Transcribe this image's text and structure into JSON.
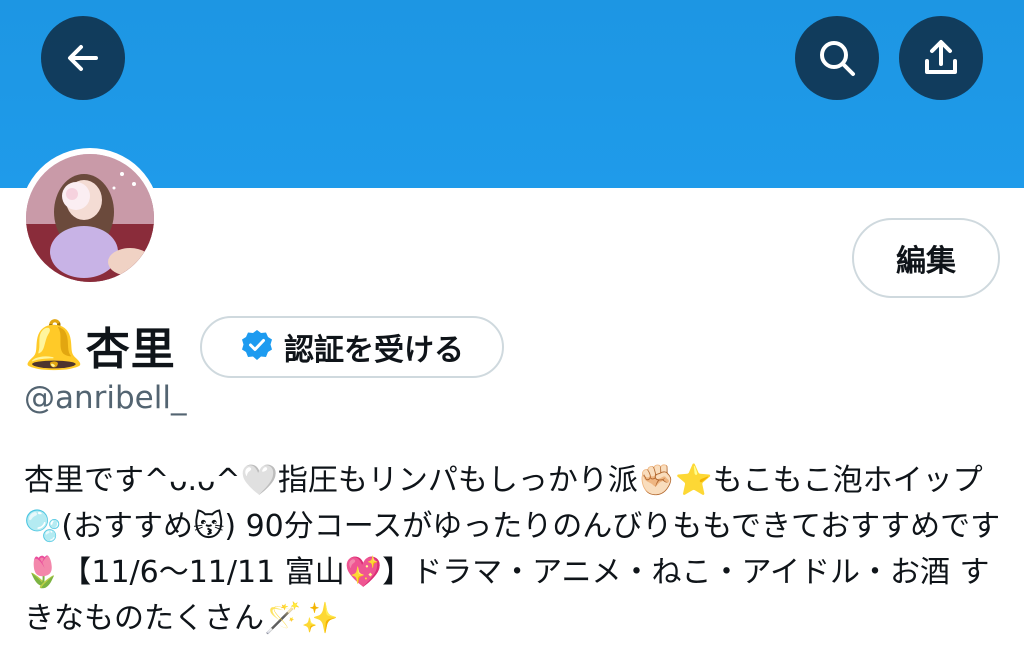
{
  "profile": {
    "display_name_icon": "🔔",
    "display_name": "杏里",
    "handle": "@anribell_",
    "bio": "杏里です^ᴗ.ᴗ^🤍指圧もリンパもしっかり派✊🏻⭐️もこもこ泡ホイップ🫧(おすすめ😽) 90分コースがゆったりのんびりももできておすすめです🌷【11/6〜11/11 富山💖】ドラマ・アニメ・ねこ・アイドル・お酒 すきなものたくさん🪄✨"
  },
  "header": {
    "banner_color": "#1d9bf0",
    "back_icon": "arrow-left-icon",
    "search_icon": "search-icon",
    "share_icon": "share-icon"
  },
  "actions": {
    "edit_label": "編集",
    "verify_label": "認証を受ける",
    "verify_icon": "verified-badge-icon",
    "verify_color": "#1d9bf0"
  }
}
